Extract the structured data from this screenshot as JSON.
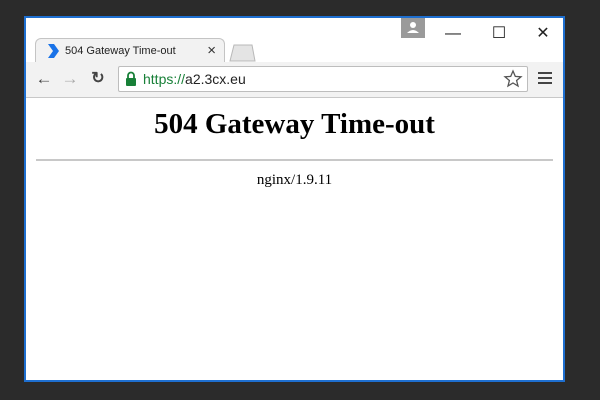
{
  "browser": {
    "tab": {
      "title": "504 Gateway Time-out",
      "close_glyph": "×"
    },
    "window_controls": {
      "minimize": "—",
      "maximize": "☐",
      "close": "✕"
    },
    "nav": {
      "back": "←",
      "forward": "→",
      "reload": "↻"
    },
    "address_bar": {
      "scheme": "https://",
      "host": "a2.3cx.eu"
    },
    "colors": {
      "frame_border": "#1e6fd0",
      "secure_green": "#188038",
      "favicon_blue": "#1a73e8"
    },
    "icons": [
      "favicon-chevron-icon",
      "new-tab-icon",
      "profile-icon",
      "lock-icon",
      "star-icon",
      "menu-icon"
    ]
  },
  "page": {
    "heading": "504 Gateway Time-out",
    "server_signature": "nginx/1.9.11"
  }
}
